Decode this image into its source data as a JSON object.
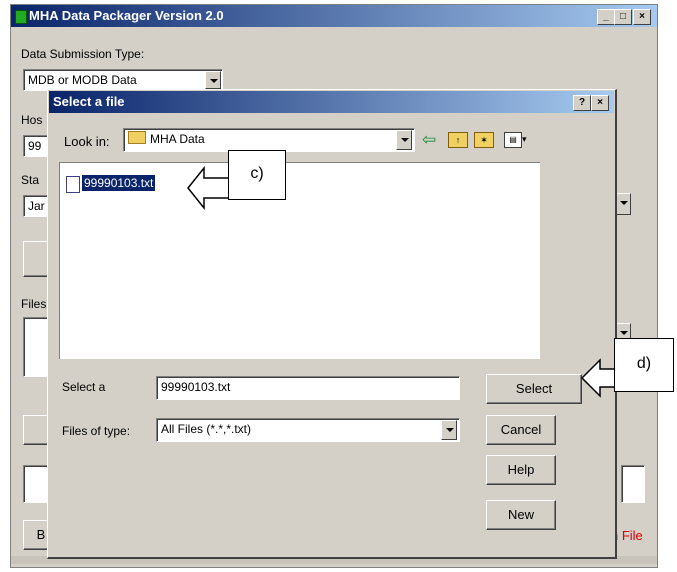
{
  "main_window": {
    "title": "MHA Data Packager Version 2.0",
    "submission_type_label": "Data Submission Type:",
    "submission_type_value": "MDB or MODB Data",
    "label_hos_partial": "Hos",
    "label_sta_partial": "Sta",
    "label_files_partial": "Files",
    "field_99_partial": "99",
    "field_jar_partial": "Jar",
    "button_b_partial": "B",
    "red_text_partial": "n File",
    "minimize": "_",
    "maximize": "□",
    "close": "×"
  },
  "dialog": {
    "title": "Select a file",
    "help_btn": "?",
    "close_btn": "×",
    "look_in_label": "Look in:",
    "look_in_value": "MHA Data",
    "files": [
      {
        "name": "99990103.txt",
        "selected": true
      }
    ],
    "select_label": "Select a",
    "select_value": "99990103.txt",
    "files_of_type_label": "Files of type:",
    "files_of_type_value": "All Files (*.*,*.txt)",
    "buttons": {
      "select": "Select",
      "cancel": "Cancel",
      "help": "Help",
      "new": "New"
    }
  },
  "annotations": {
    "c": "c)",
    "d": "d)"
  }
}
